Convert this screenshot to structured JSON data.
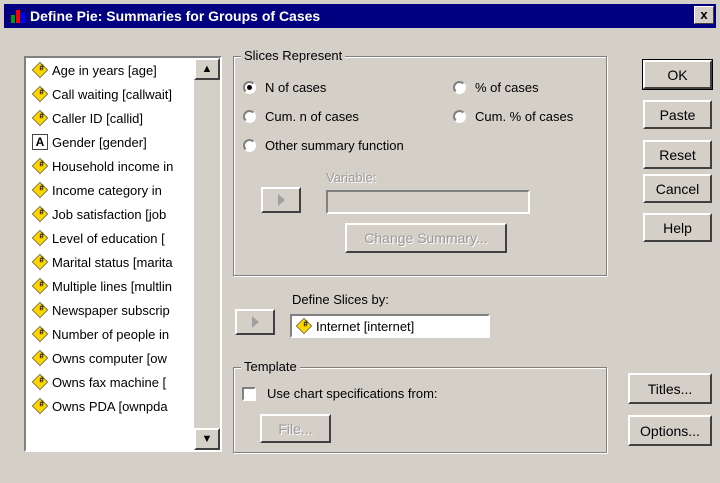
{
  "window": {
    "title": "Define Pie: Summaries for Groups of Cases",
    "close_label": "x",
    "app_icon_colors": [
      "#00a000",
      "#ff0000",
      "#0000ff"
    ]
  },
  "variables": [
    {
      "label": "Age in years [age]",
      "icon": "scalar-icon"
    },
    {
      "label": "Call waiting [callwait]",
      "icon": "scalar-icon"
    },
    {
      "label": "Caller ID [callid]",
      "icon": "scalar-icon"
    },
    {
      "label": "Gender [gender]",
      "icon": "nominal-icon"
    },
    {
      "label": "Household income in",
      "icon": "scalar-icon"
    },
    {
      "label": "Income category in",
      "icon": "scalar-icon"
    },
    {
      "label": "Job satisfaction [job",
      "icon": "scalar-icon"
    },
    {
      "label": "Level of education [",
      "icon": "scalar-icon"
    },
    {
      "label": "Marital status [marita",
      "icon": "scalar-icon"
    },
    {
      "label": "Multiple lines [multlin",
      "icon": "scalar-icon"
    },
    {
      "label": "Newspaper subscrip",
      "icon": "scalar-icon"
    },
    {
      "label": "Number of people in",
      "icon": "scalar-icon"
    },
    {
      "label": "Owns computer [ow",
      "icon": "scalar-icon"
    },
    {
      "label": "Owns fax machine [",
      "icon": "scalar-icon"
    },
    {
      "label": "Owns PDA [ownpda",
      "icon": "scalar-icon"
    }
  ],
  "nominal_icon_text": "A",
  "slices": {
    "title": "Slices Represent",
    "n_of_cases": "N of cases",
    "pct_of_cases": "% of cases",
    "cum_n": "Cum. n of cases",
    "cum_pct": "Cum. % of cases",
    "other": "Other summary function",
    "selected": "n_of_cases",
    "variable_label": "Variable:",
    "variable_value": "",
    "change_summary": "Change Summary..."
  },
  "define_slices": {
    "label": "Define Slices by:",
    "value": "Internet [internet]",
    "icon": "scalar-icon"
  },
  "template": {
    "title": "Template",
    "checkbox_label": "Use chart specifications from:",
    "checked": false,
    "file_button": "File..."
  },
  "buttons": {
    "ok": "OK",
    "paste": "Paste",
    "reset": "Reset",
    "cancel": "Cancel",
    "help": "Help",
    "titles": "Titles...",
    "options": "Options..."
  },
  "scroll": {
    "up": "▲",
    "down": "▼"
  }
}
